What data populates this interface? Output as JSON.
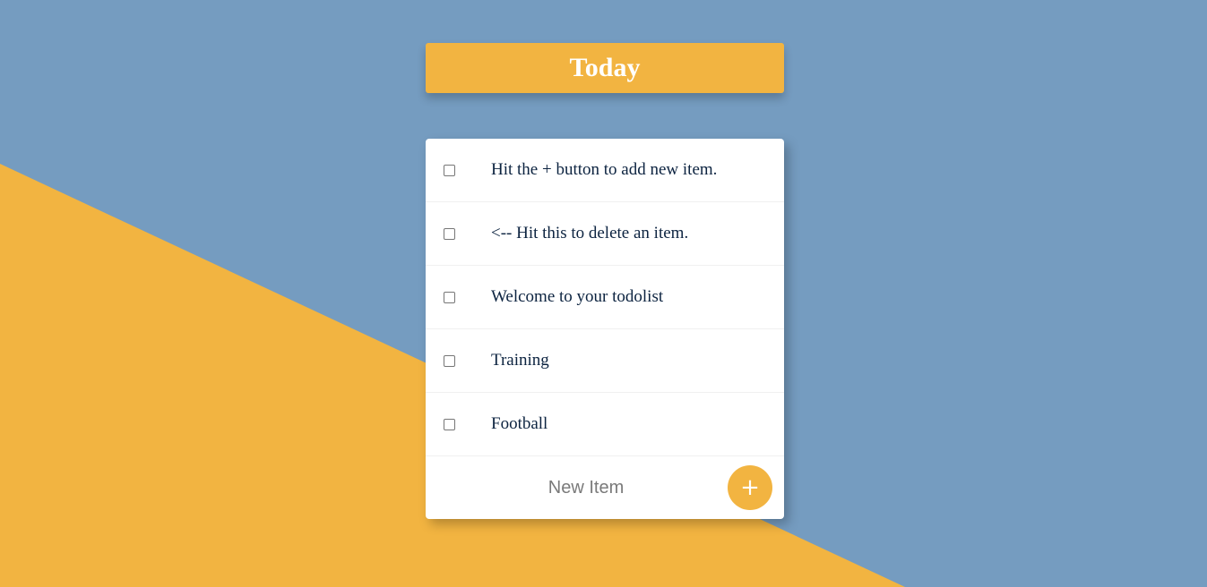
{
  "colors": {
    "background": "#759cc0",
    "accent": "#f2b441",
    "card": "#ffffff",
    "item_text": "#0c2340"
  },
  "header": {
    "title": "Today"
  },
  "todo": {
    "items": [
      {
        "text": "Hit the + button to add new item.",
        "checked": false
      },
      {
        "text": "<-- Hit this to delete an item.",
        "checked": false
      },
      {
        "text": "Welcome to your todolist",
        "checked": false
      },
      {
        "text": "Training",
        "checked": false
      },
      {
        "text": "Football",
        "checked": false
      }
    ],
    "new_item": {
      "placeholder": "New Item",
      "value": ""
    },
    "add_button_label": "+"
  }
}
